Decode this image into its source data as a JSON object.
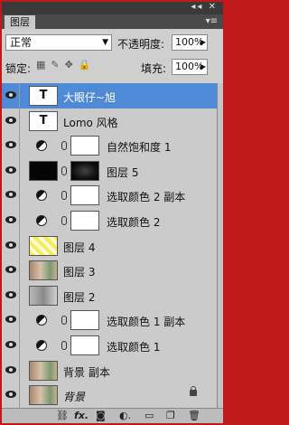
{
  "window": {
    "tab_label": "图层",
    "close_glyph": "◂◂ ✕",
    "menu_glyph": "▾≡"
  },
  "options": {
    "blend_mode": "正常",
    "opacity_label": "不透明度:",
    "opacity_value": "100%",
    "lock_label": "锁定:",
    "fill_label": "填充:",
    "fill_value": "100%"
  },
  "layers": [
    {
      "name": "大眼仔~旭",
      "type": "text",
      "selected": true
    },
    {
      "name": "Lomo 风格",
      "type": "text",
      "selected": false
    },
    {
      "name": "自然饱和度 1",
      "type": "adjustment",
      "selected": false
    },
    {
      "name": "图层 5",
      "type": "image-dark",
      "selected": false
    },
    {
      "name": "选取颜色 2 副本",
      "type": "adjustment",
      "selected": false
    },
    {
      "name": "选取颜色 2",
      "type": "adjustment",
      "selected": false
    },
    {
      "name": "图层 4",
      "type": "image-yellow",
      "selected": false
    },
    {
      "name": "图层 3",
      "type": "image-photo",
      "selected": false
    },
    {
      "name": "图层 2",
      "type": "image-photo-gray",
      "selected": false
    },
    {
      "name": "选取颜色 1 副本",
      "type": "adjustment",
      "selected": false
    },
    {
      "name": "选取颜色 1",
      "type": "adjustment",
      "selected": false
    },
    {
      "name": "背景 副本",
      "type": "image-photo",
      "selected": false
    },
    {
      "name": "背景",
      "type": "image-photo",
      "selected": false,
      "locked": true
    }
  ],
  "bottom_icons": [
    "link-icon",
    "fx-icon",
    "mask-icon",
    "adjustment-icon",
    "folder-icon",
    "new-layer-icon",
    "trash-icon"
  ],
  "bottom_glyphs": {
    "link": "⛓",
    "fx": "fx.",
    "mask": "◙",
    "adjust": "◐.",
    "folder": "▭",
    "new": "❐",
    "trash": "🗑"
  }
}
